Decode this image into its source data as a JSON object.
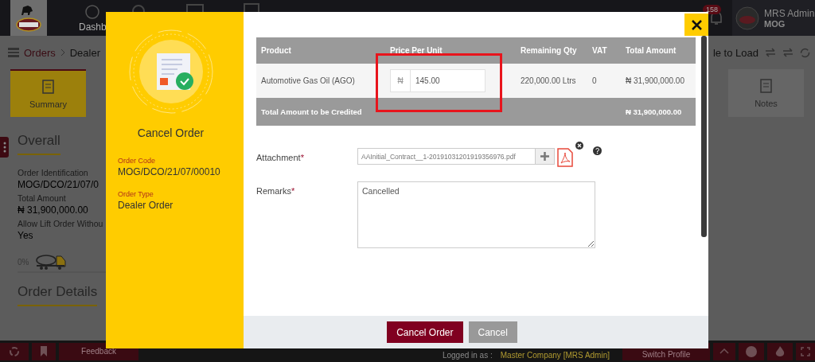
{
  "top_bar": {
    "nav_label": "Dashb",
    "notification_count": "158",
    "user": {
      "name": "MRS Admin",
      "org": "MOG"
    }
  },
  "breadcrumb": [
    "Orders",
    "Dealer"
  ],
  "toolbar_text": "le to Load",
  "tabs": [
    {
      "label": "Summary",
      "selected": true
    },
    {
      "label": "Notes",
      "selected": false
    }
  ],
  "overall": {
    "heading": "Overall",
    "fields": [
      {
        "label": "Order Identification",
        "value": "MOG/DCO/21/07/0"
      },
      {
        "label": "Total Amount",
        "value": "₦ 31,900,000.00"
      },
      {
        "label": "Allow Lift Order Withou",
        "value": "Yes"
      }
    ],
    "progress": {
      "reading": "0%"
    }
  },
  "order_details_heading": "Order Details",
  "footer": {
    "feedback": "Feedback",
    "logged_in_label": "Logged in as :",
    "logged_in_value": "Master Company [MRS Admin]",
    "switch_profile": "Switch Profile"
  },
  "modal": {
    "title": "Cancel Order",
    "info": [
      {
        "label": "Order Code",
        "value": "MOG/DCO/21/07/00010"
      },
      {
        "label": "Order Type",
        "value": "Dealer Order"
      }
    ],
    "table": {
      "columns": [
        "Product",
        "Price Per Unit",
        "Remaining Qty",
        "VAT",
        "Total Amount"
      ],
      "rows": [
        {
          "product": "Automotive Gas Oil (AGO)",
          "currency": "₦",
          "price": "145.00",
          "remaining_qty": "220,000.00 Ltrs",
          "vat": "0",
          "total": "₦ 31,900,000.00"
        }
      ],
      "total_label": "Total Amount to be Credited",
      "total_value": "₦ 31,900,000.00"
    },
    "attachment": {
      "label": "Attachment",
      "required_mark": "*",
      "file": "AAInitial_Contract__1-20191031201919356976.pdf"
    },
    "remarks": {
      "label": "Remarks",
      "required_mark": "*",
      "value": "Cancelled"
    },
    "buttons": [
      {
        "label": "Cancel Order",
        "kind": "primary"
      },
      {
        "label": "Cancel",
        "kind": "secondary"
      }
    ]
  }
}
